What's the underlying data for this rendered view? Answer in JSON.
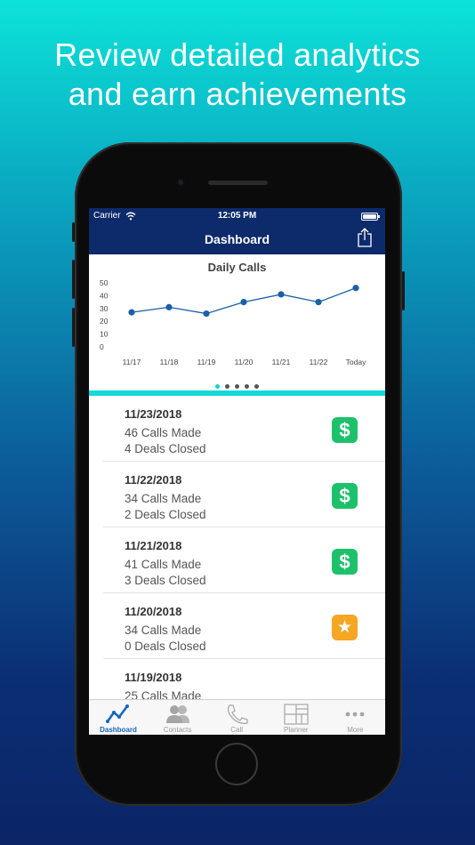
{
  "headline": {
    "line1": "Review detailed analytics",
    "line2": "and earn achievements"
  },
  "status_bar": {
    "carrier": "Carrier",
    "time": "12:05 PM"
  },
  "nav": {
    "title": "Dashboard",
    "share_icon": "share-icon"
  },
  "chart_data": {
    "type": "line",
    "title": "Daily Calls",
    "categories": [
      "11/17",
      "11/18",
      "11/19",
      "11/20",
      "11/21",
      "11/22",
      "Today"
    ],
    "series": [
      {
        "values": [
          27,
          31,
          26,
          35,
          41,
          35,
          46
        ]
      }
    ],
    "ylim": [
      0,
      50
    ],
    "yticks": [
      0,
      10,
      20,
      30,
      40,
      50
    ],
    "grid": false,
    "line_color": "#1a5fa8"
  },
  "pager": {
    "count": 5,
    "active": 0
  },
  "entries": [
    {
      "date": "11/23/2018",
      "calls": "46 Calls Made",
      "deals": "4 Deals Closed",
      "badge": "dollar",
      "badge_symbol": "$"
    },
    {
      "date": "11/22/2018",
      "calls": "34 Calls Made",
      "deals": "2 Deals Closed",
      "badge": "dollar",
      "badge_symbol": "$"
    },
    {
      "date": "11/21/2018",
      "calls": "41 Calls Made",
      "deals": "3 Deals Closed",
      "badge": "dollar",
      "badge_symbol": "$"
    },
    {
      "date": "11/20/2018",
      "calls": "34 Calls Made",
      "deals": "0 Deals Closed",
      "badge": "star",
      "badge_symbol": "★"
    },
    {
      "date": "11/19/2018",
      "calls": "25 Calls Made",
      "deals": "",
      "badge": "",
      "badge_symbol": ""
    }
  ],
  "tabs": [
    {
      "label": "Dashboard",
      "icon": "chart-line-icon",
      "active": true
    },
    {
      "label": "Contacts",
      "icon": "contacts-icon",
      "active": false
    },
    {
      "label": "Call",
      "icon": "phone-icon",
      "active": false
    },
    {
      "label": "Planner",
      "icon": "planner-grid-icon",
      "active": false
    },
    {
      "label": "More",
      "icon": "more-dots-icon",
      "active": false
    }
  ],
  "colors": {
    "nav_bar": "#0d2a6b",
    "accent_teal": "#15d8d8",
    "badge_green": "#1ec16b",
    "badge_orange": "#f5a623",
    "tab_active": "#1565c0"
  }
}
